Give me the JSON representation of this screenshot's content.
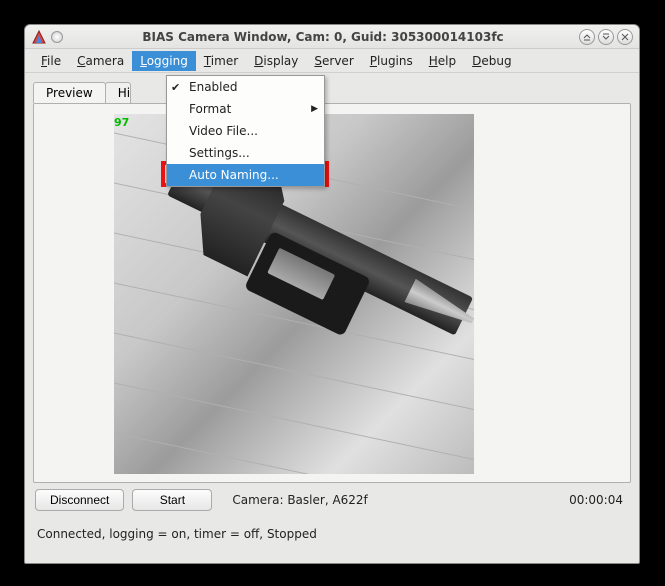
{
  "window": {
    "title": "BIAS Camera Window, Cam: 0, Guid: 305300014103fc"
  },
  "menubar": {
    "items": [
      {
        "label": "File",
        "mn": "F",
        "rest": "ile"
      },
      {
        "label": "Camera",
        "mn": "C",
        "rest": "amera"
      },
      {
        "label": "Logging",
        "mn": "L",
        "rest": "ogging"
      },
      {
        "label": "Timer",
        "mn": "T",
        "rest": "imer"
      },
      {
        "label": "Display",
        "mn": "D",
        "rest": "isplay"
      },
      {
        "label": "Server",
        "mn": "S",
        "rest": "erver"
      },
      {
        "label": "Plugins",
        "mn": "P",
        "rest": "lugins"
      },
      {
        "label": "Help",
        "mn": "H",
        "rest": "elp"
      },
      {
        "label": "Debug",
        "mn": "D",
        "rest": "ebug"
      }
    ],
    "active_index": 2
  },
  "dropdown": {
    "items": [
      {
        "label": "Enabled",
        "checked": true,
        "submenu": false
      },
      {
        "label": "Format",
        "checked": false,
        "submenu": true
      },
      {
        "label": "Video File...",
        "checked": false,
        "submenu": false
      },
      {
        "label": "Settings...",
        "checked": false,
        "submenu": false
      },
      {
        "label": "Auto Naming...",
        "checked": false,
        "submenu": false
      }
    ],
    "highlight_index": 4
  },
  "tabs": {
    "items": [
      "Preview",
      "His"
    ],
    "active_index": 0
  },
  "preview": {
    "fps_overlay": "97"
  },
  "footer": {
    "disconnect_label": "Disconnect",
    "start_label": "Start",
    "camera_label": "Camera:  Basler,  A622f",
    "time_label": "00:00:04"
  },
  "status": {
    "text": "Connected, logging = on, timer = off, Stopped"
  }
}
